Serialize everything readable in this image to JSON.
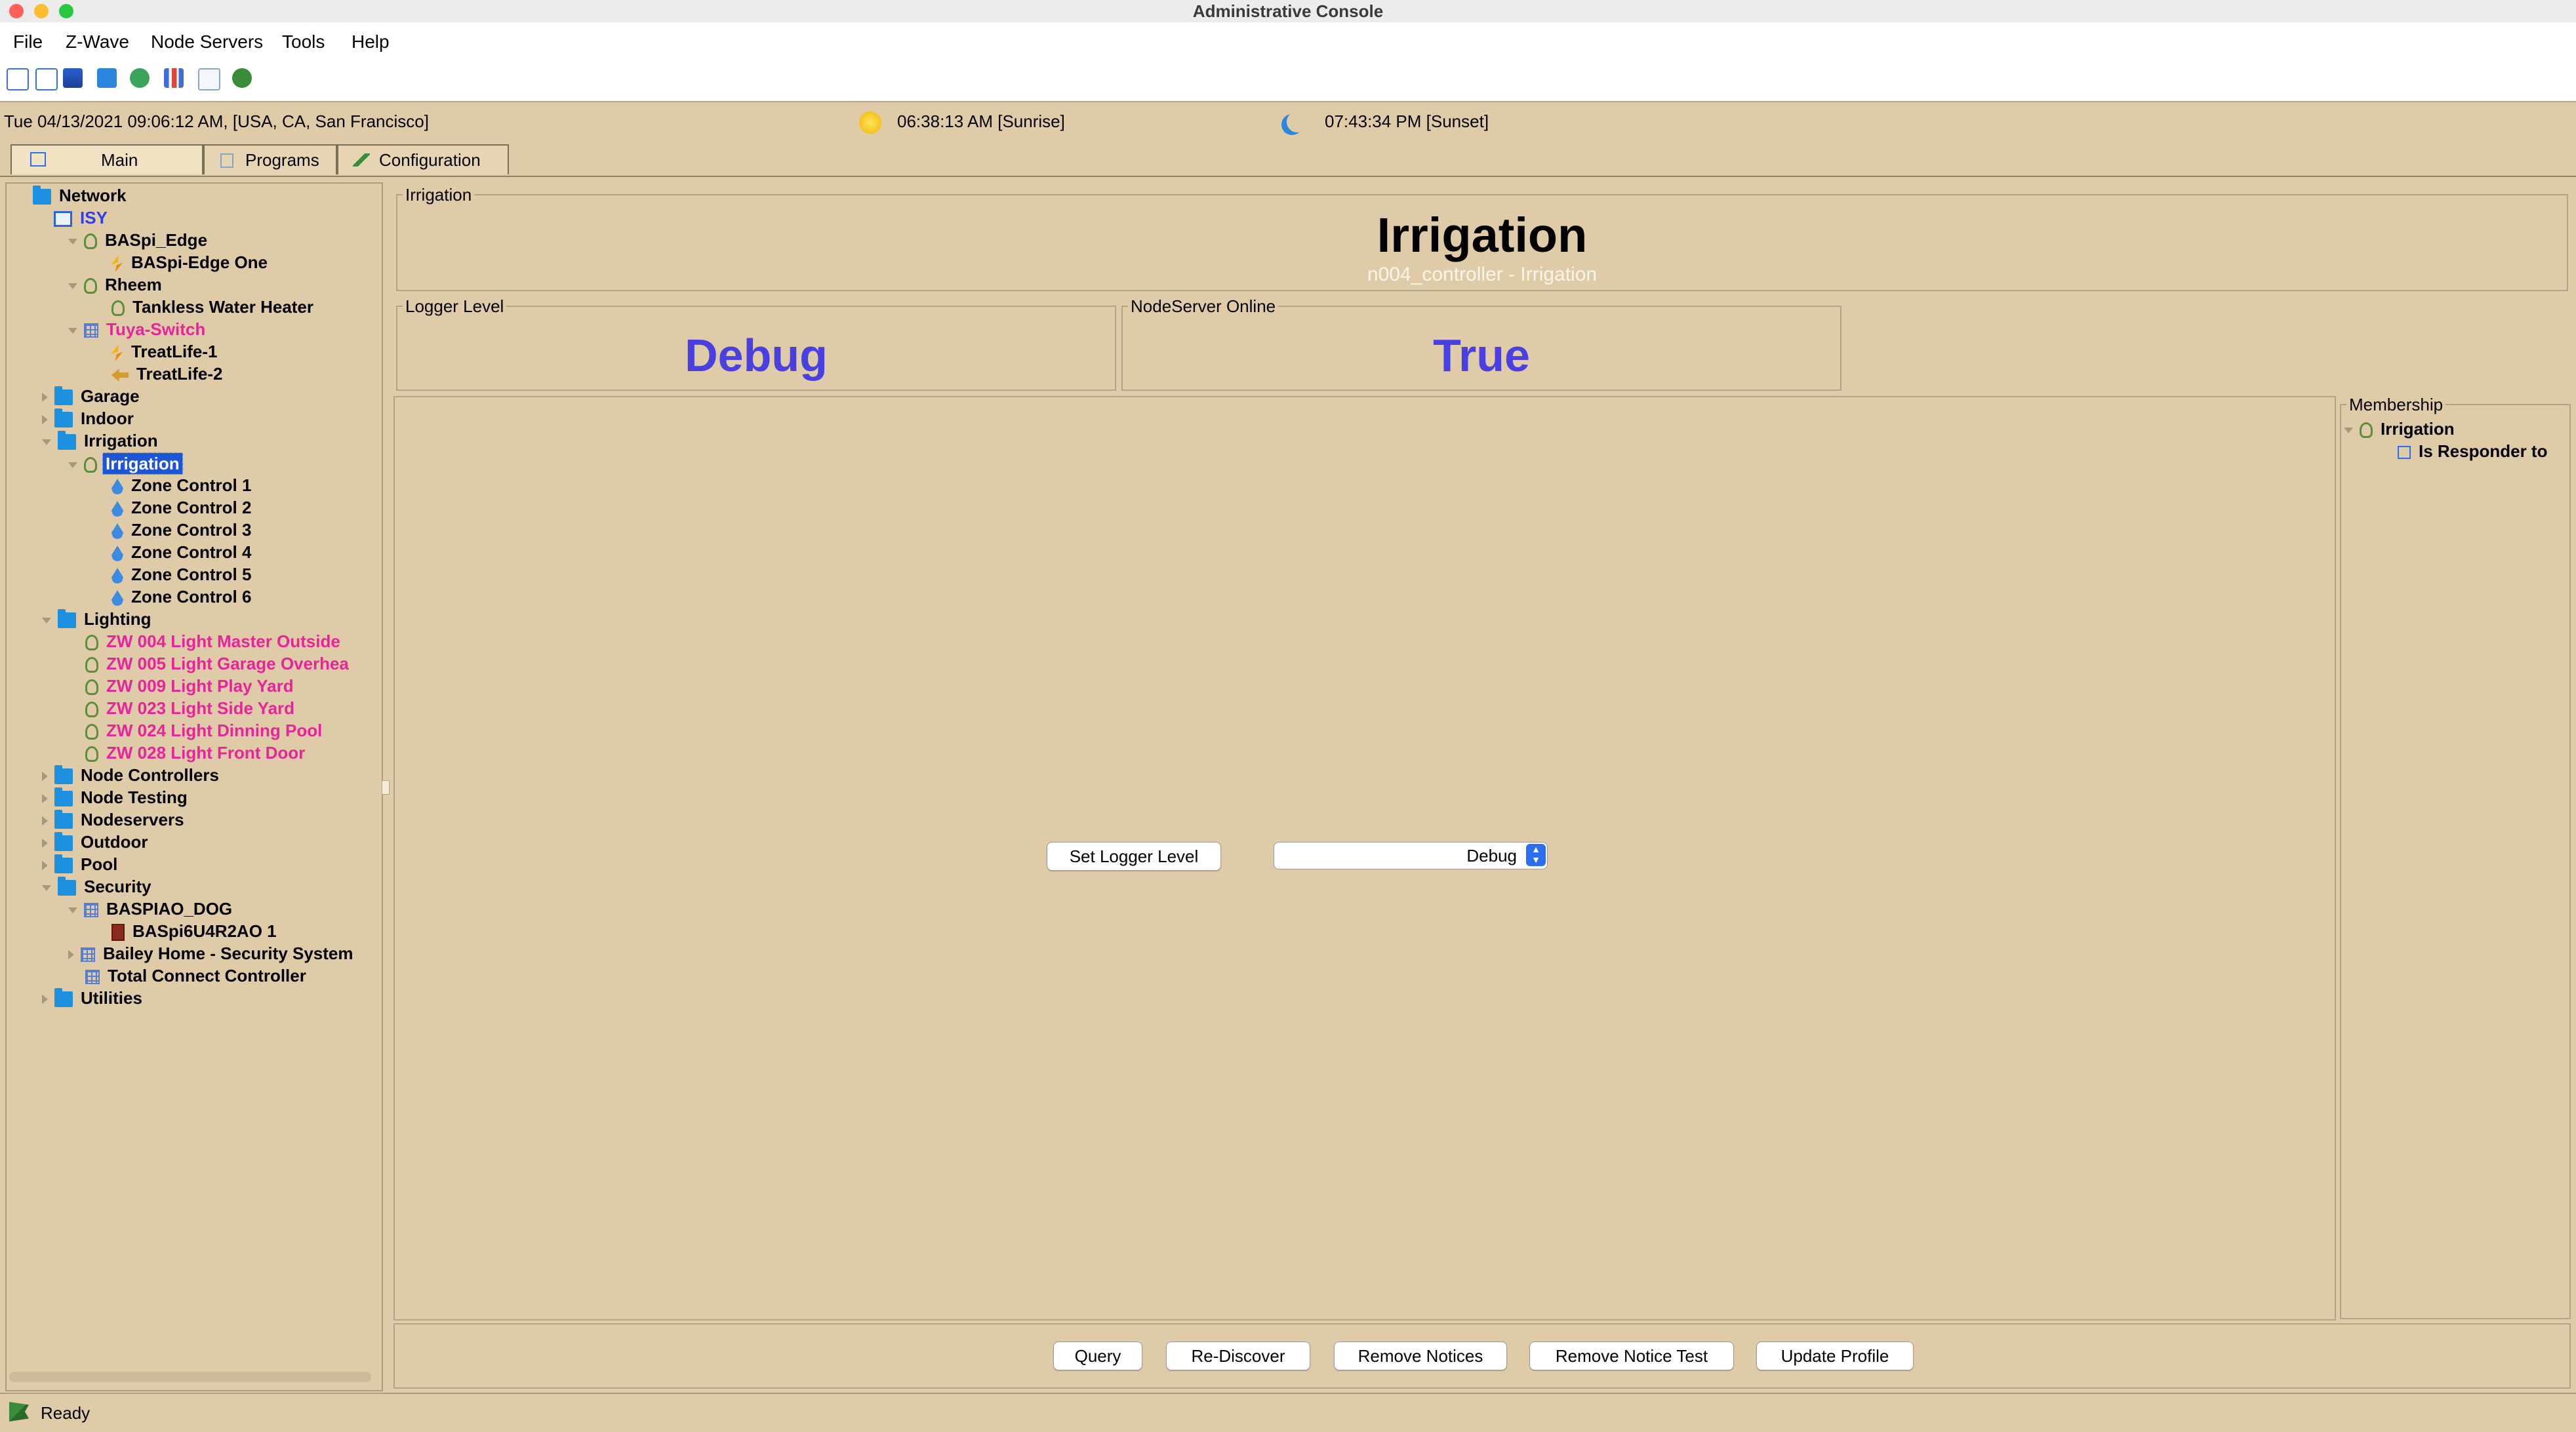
{
  "window": {
    "title": "Administrative Console"
  },
  "menu": [
    "File",
    "Z-Wave",
    "Node Servers",
    "Tools",
    "Help"
  ],
  "datetime": "Tue 04/13/2021 09:06:12 AM,  [USA, CA, San Francisco]",
  "sunrise": "06:38:13 AM [Sunrise]",
  "sunset": "07:43:34 PM [Sunset]",
  "tabs": {
    "main": "Main",
    "programs": "Programs",
    "configuration": "Configuration"
  },
  "tree": {
    "network": "Network",
    "isy": "ISY",
    "baspi_edge": "BASpi_Edge",
    "baspi_edge_one": "BASpi-Edge One",
    "rheem": "Rheem",
    "tankless": "Tankless Water Heater",
    "tuya": "Tuya-Switch",
    "treatlife1": "TreatLife-1",
    "treatlife2": "TreatLife-2",
    "garage": "Garage",
    "indoor": "Indoor",
    "irrigation_folder": "Irrigation",
    "irrigation_node": "Irrigation",
    "zones": [
      "Zone Control 1",
      "Zone Control 2",
      "Zone Control 3",
      "Zone Control 4",
      "Zone Control 5",
      "Zone Control 6"
    ],
    "lighting": "Lighting",
    "lights": [
      "ZW 004 Light Master Outside",
      "ZW 005 Light Garage Overhea",
      "ZW 009 Light Play Yard",
      "ZW 023 Light Side Yard",
      "ZW 024 Light Dinning Pool",
      "ZW 028 Light Front Door"
    ],
    "node_controllers": "Node Controllers",
    "node_testing": "Node Testing",
    "nodeservers": "Nodeservers",
    "outdoor": "Outdoor",
    "pool": "Pool",
    "security": "Security",
    "baspiao_dog": "BASPIAO_DOG",
    "baspi6u": "BASpi6U4R2AO 1",
    "bailey": "Bailey Home - Security System",
    "total_connect": "Total Connect Controller",
    "utilities": "Utilities"
  },
  "header": {
    "legend": "Irrigation",
    "title": "Irrigation",
    "subtitle": "n004_controller - Irrigation"
  },
  "logger": {
    "legend": "Logger Level",
    "value": "Debug"
  },
  "online": {
    "legend": "NodeServer Online",
    "value": "True"
  },
  "controls": {
    "set_logger": "Set Logger Level",
    "selected": "Debug"
  },
  "membership": {
    "legend": "Membership",
    "node": "Irrigation",
    "responder": "Is Responder to"
  },
  "buttons": {
    "query": "Query",
    "rediscover": "Re-Discover",
    "remove_notices": "Remove Notices",
    "remove_notice_test": "Remove Notice Test",
    "update_profile": "Update Profile"
  },
  "status": "Ready",
  "colors": {
    "background": "#dfcba8",
    "accent_value": "#4a3fe0",
    "pink_node": "#e8239b",
    "selection": "#1d55d6"
  }
}
